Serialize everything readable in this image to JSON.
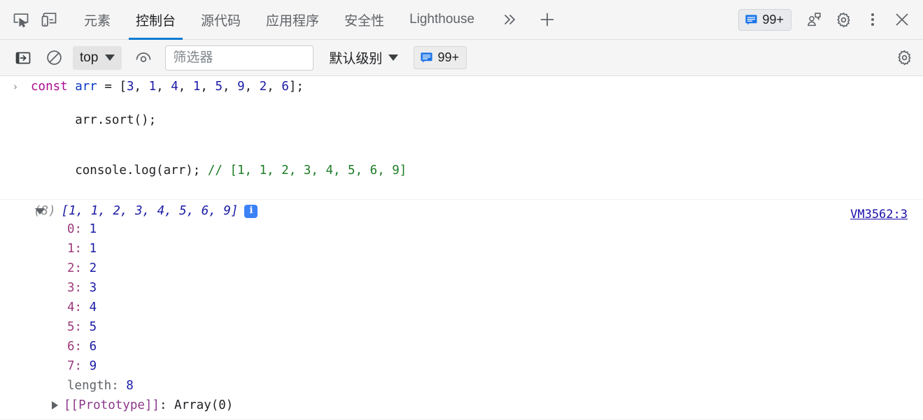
{
  "tabbar": {
    "inspect_icon": "inspect-element-icon",
    "device_icon": "device-toolbar-icon",
    "tabs": [
      {
        "label": "元素",
        "name": "tab-elements",
        "active": false
      },
      {
        "label": "控制台",
        "name": "tab-console",
        "active": true
      },
      {
        "label": "源代码",
        "name": "tab-sources",
        "active": false
      },
      {
        "label": "应用程序",
        "name": "tab-application",
        "active": false
      },
      {
        "label": "安全性",
        "name": "tab-security",
        "active": false
      },
      {
        "label": "Lighthouse",
        "name": "tab-lighthouse",
        "active": false
      }
    ],
    "more_tabs_label": "»",
    "add_tab_label": "+",
    "message_badge": "99+",
    "feedback_icon": "feedback-icon",
    "settings_icon": "gear-icon",
    "more_icon": "kebab-menu-icon",
    "close_icon": "close-icon"
  },
  "console_toolbar": {
    "sidebar_icon": "console-sidebar-icon",
    "clear_icon": "clear-console-icon",
    "context_value": "top",
    "eye_icon": "live-expression-icon",
    "filter_placeholder": "筛选器",
    "filter_value": "",
    "level_label": "默认级别",
    "issues_badge": "99+",
    "settings_icon": "gear-icon"
  },
  "console": {
    "prompt_arrow": "›",
    "input": {
      "line1": {
        "kw": "const",
        "var": "arr",
        "eq": " = [",
        "nums": [
          "3",
          "1",
          "4",
          "1",
          "5",
          "9",
          "2",
          "6"
        ],
        "tail": "];"
      },
      "line2": "arr.sort();",
      "line3_code": "console.log(arr); ",
      "line3_comment": "// [1, 1, 2, 3, 4, 5, 6, 9]"
    },
    "result": {
      "length_label": "(8)",
      "preview": "[1, 1, 2, 3, 4, 5, 6, 9]",
      "info_icon_label": "i",
      "source_link": "VM3562:3",
      "properties": [
        {
          "key": "0",
          "value": "1",
          "type": "index"
        },
        {
          "key": "1",
          "value": "1",
          "type": "index"
        },
        {
          "key": "2",
          "value": "2",
          "type": "index"
        },
        {
          "key": "3",
          "value": "3",
          "type": "index"
        },
        {
          "key": "4",
          "value": "4",
          "type": "index"
        },
        {
          "key": "5",
          "value": "5",
          "type": "index"
        },
        {
          "key": "6",
          "value": "6",
          "type": "index"
        },
        {
          "key": "7",
          "value": "9",
          "type": "index"
        },
        {
          "key": "length",
          "value": "8",
          "type": "length"
        }
      ],
      "prototype_key": "[[Prototype]]",
      "prototype_value": "Array(0)"
    }
  },
  "colors": {
    "accent": "#0b7ad1",
    "keyword": "#aa0d91",
    "number": "#1a1aa6",
    "comment": "#1d7c25",
    "link": "#1a0dab",
    "info": "#3b82f6"
  }
}
